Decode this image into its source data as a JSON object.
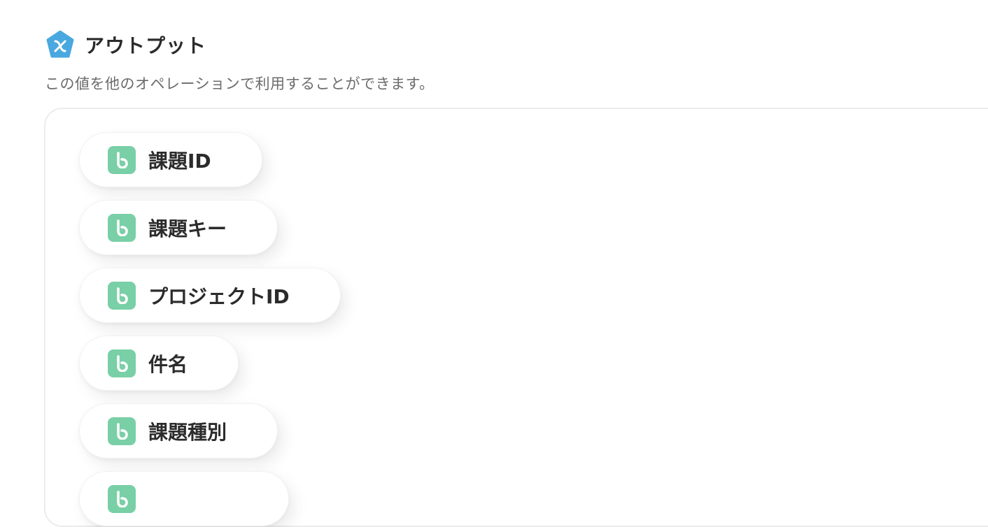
{
  "header": {
    "icon": "yoom-variable-icon",
    "title": "アウトプット",
    "description": "この値を他のオペレーションで利用することができます。"
  },
  "outputs": [
    {
      "label": "課題ID",
      "icon": "backlog-icon"
    },
    {
      "label": "課題キー",
      "icon": "backlog-icon"
    },
    {
      "label": "プロジェクトID",
      "icon": "backlog-icon"
    },
    {
      "label": "件名",
      "icon": "backlog-icon"
    },
    {
      "label": "課題種別",
      "icon": "backlog-icon"
    },
    {
      "label": "",
      "icon": "backlog-icon"
    }
  ],
  "colors": {
    "header_icon": "#4aa8e0",
    "chip_icon": "#79cfa6"
  }
}
